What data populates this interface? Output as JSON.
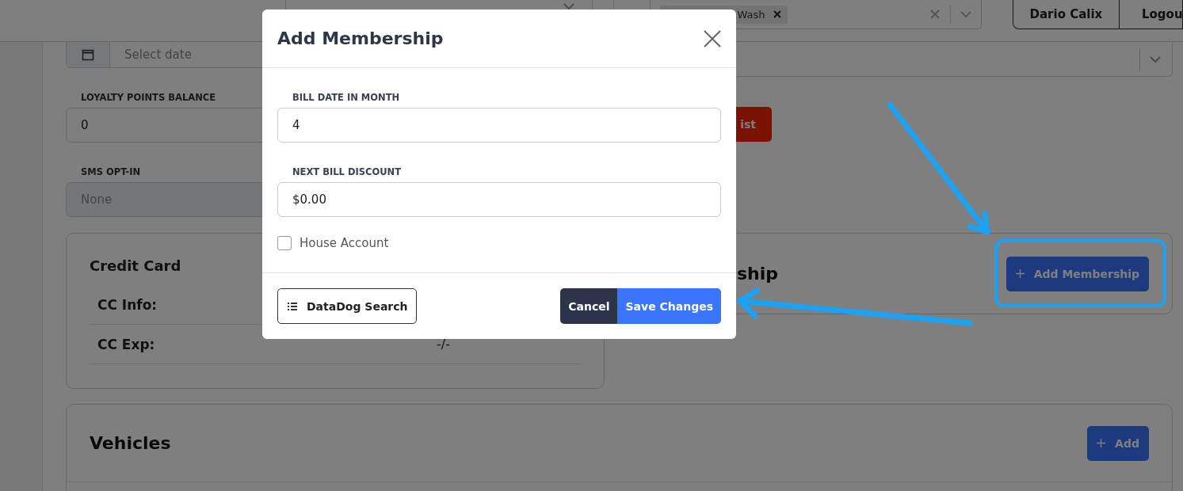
{
  "header": {
    "site_filter": {
      "tags": [
        {
          "label": "Wash"
        }
      ]
    },
    "user_button": "Dario Calix",
    "logout_button": "Logou"
  },
  "customer_form": {
    "date_field": {
      "placeholder": "Select date"
    },
    "loyalty_points": {
      "label": "LOYALTY POINTS BALANCE",
      "value": "0"
    },
    "sms_opt_in": {
      "label": "SMS OPT-IN",
      "value": "None",
      "disabled": true
    },
    "action_button": "ist"
  },
  "credit_card": {
    "title": "Credit Card",
    "rows": [
      {
        "label": "CC Info:"
      },
      {
        "label": "CC Exp:",
        "value": "-/-"
      }
    ]
  },
  "membership": {
    "title": "ship",
    "add_button": "Add Membership"
  },
  "vehicles": {
    "title": "Vehicles",
    "add_button": "Add"
  },
  "modal": {
    "title": "Add Membership",
    "fields": [
      {
        "label": "BILL DATE IN MONTH",
        "value": "4"
      },
      {
        "label": "NEXT BILL DISCOUNT",
        "value": "$0.00"
      }
    ],
    "house_account": {
      "label": "House Account",
      "checked": false
    },
    "datadog_button": "DataDog Search",
    "cancel_button": "Cancel",
    "save_button": "Save Changes"
  }
}
